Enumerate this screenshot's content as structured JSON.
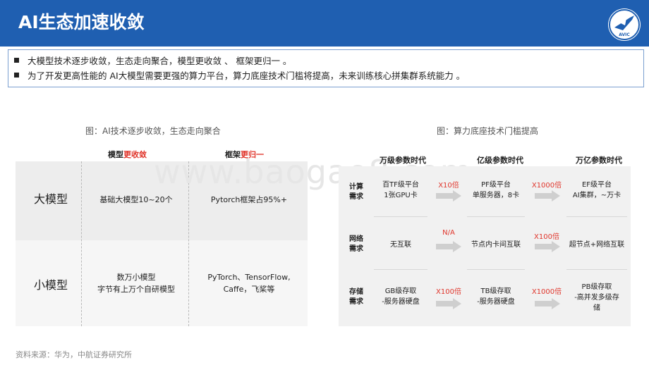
{
  "header": {
    "title": "AI生态加速收敛",
    "logo_text": "AVIC",
    "logo_icon": "aircraft-logo"
  },
  "bullets": [
    "大模型技术逐步收敛，生态走向聚合，模型更收敛 、 框架更归一 。",
    "为了开发更高性能的 AI大模型需要更强的算力平台，算力底座技术门槛将提高，未来训练核心拼集群系统能力 。"
  ],
  "watermark": "www.baogao8.com",
  "left_figure": {
    "caption": "图：AI技术逐步收敛，生态走向聚合",
    "col1": {
      "prefix": "模型",
      "highlight": "更收敛"
    },
    "col2": {
      "prefix": "框架",
      "highlight": "更归一"
    },
    "rows": [
      {
        "label": "大模型",
        "c1": "基础大模型10~20个",
        "c2": "Pytorch框架占95%+"
      },
      {
        "label": "小模型",
        "c1_line1": "数万小模型",
        "c1_line2": "字节有上万个自研模型",
        "c2_line1": "PyTorch、TensorFlow,",
        "c2_line2": "Caffe，飞桨等"
      }
    ]
  },
  "right_figure": {
    "caption": "图：算力底座技术门槛提高",
    "eras": [
      "万级参数时代",
      "亿级参数时代",
      "万亿参数时代"
    ],
    "rows": [
      {
        "label1": "计算",
        "label2": "需求",
        "e1_line1": "百TF级平台",
        "e1_line2": "1张GPU卡",
        "a1": "X10倍",
        "e2_line1": "PF级平台",
        "e2_line2": "单服务器，8卡",
        "a2": "X1000倍",
        "e3_line1": "EF级平台",
        "e3_line2": "AI集群，~万卡"
      },
      {
        "label1": "网络",
        "label2": "需求",
        "e1_line1": "无互联",
        "a1": "N/A",
        "e2_line1": "节点内卡间互联",
        "a2": "X100倍",
        "e3_line1": "超节点+网络互联"
      },
      {
        "label1": "存储",
        "label2": "需求",
        "e1_line1": "GB级存取",
        "e1_line2": "-服务器硬盘",
        "a1": "X100倍",
        "e2_line1": "TB级存取",
        "e2_line2": "-服务器硬盘",
        "a2": "X1000倍",
        "e3_line1": "PB级存取",
        "e3_line2": "-高并发多级存",
        "e3_line3": "储"
      }
    ]
  },
  "source": "资料来源：华为，中航证券研究所"
}
